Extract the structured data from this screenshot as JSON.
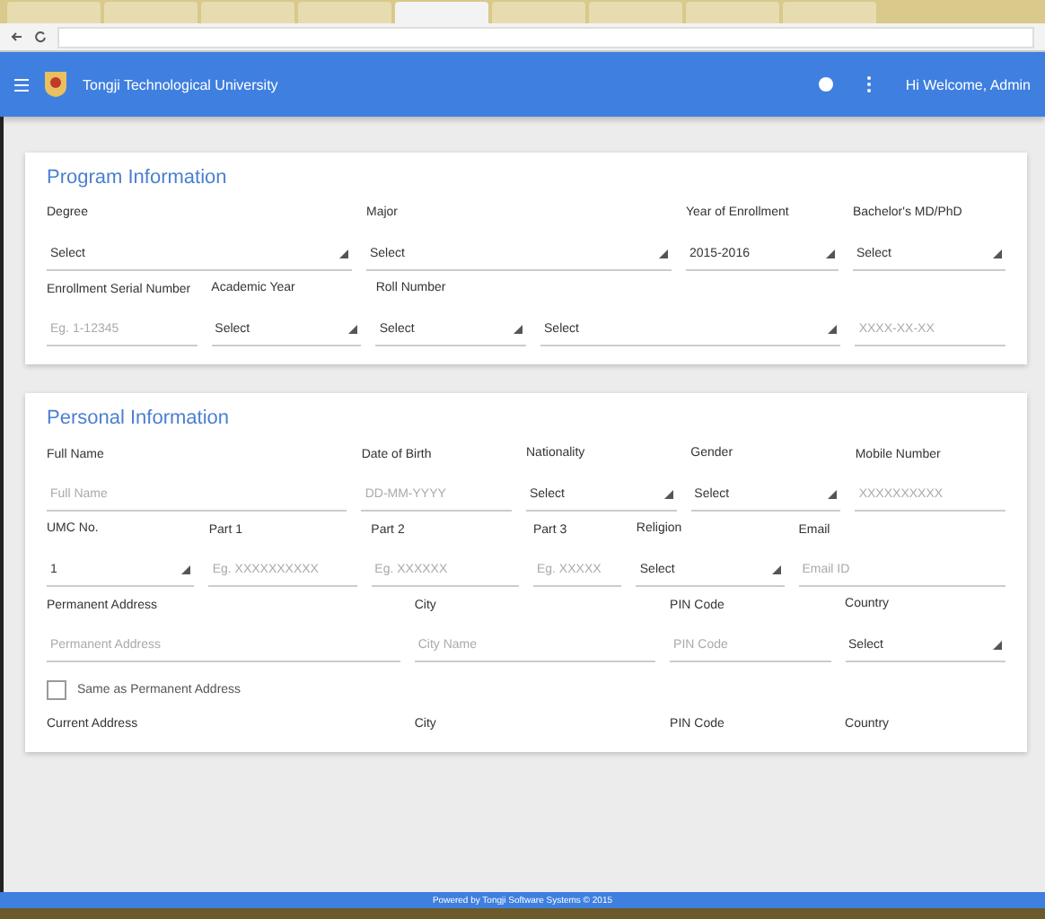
{
  "browser_tabs": [
    {
      "selected": false
    },
    {
      "selected": false
    },
    {
      "selected": false
    },
    {
      "selected": false
    },
    {
      "selected": true
    },
    {
      "selected": false
    },
    {
      "selected": false
    },
    {
      "selected": false
    },
    {
      "selected": false
    }
  ],
  "app_bar": {
    "title": "Tongji Technological University",
    "user": "Hi Welcome, Admin"
  },
  "sections": [
    {
      "title": "Program Information",
      "rows": [
        {
          "fields": [
            {
              "label": "Degree",
              "kind": "select",
              "value": "Select"
            },
            {
              "label": "Major",
              "kind": "select",
              "value": "Select"
            },
            {
              "label": "Year of Enrollment",
              "kind": "select",
              "value": "2015-2016"
            },
            {
              "label": "Bachelor's MD/PhD",
              "kind": "select",
              "value": "Select"
            }
          ]
        },
        {
          "fields": [
            {
              "label": "Enrollment Serial Number",
              "kind": "text",
              "placeholder": "Eg. 1-12345"
            },
            {
              "label": "Academic Year",
              "kind": "select",
              "value": "Select"
            },
            {
              "label": "Roll Number",
              "kind": "select",
              "value": "Select"
            },
            {
              "kind": "select",
              "value": "Select"
            },
            {
              "kind": "text",
              "placeholder": "XXXX-XX-XX"
            }
          ]
        }
      ]
    },
    {
      "title": "Personal Information",
      "rows": [
        {
          "fields": [
            {
              "label": "Full Name",
              "kind": "text",
              "placeholder": "Full Name"
            },
            {
              "label": "Date of Birth",
              "kind": "text",
              "placeholder": "DD-MM-YYYY"
            },
            {
              "label": "Nationality",
              "kind": "select",
              "value": "Select"
            },
            {
              "label": "Gender",
              "kind": "select",
              "value": "Select"
            },
            {
              "label": "Mobile Number",
              "kind": "text",
              "placeholder": "XXXXXXXXXX"
            }
          ]
        },
        {
          "fields": [
            {
              "label": "UMC No.",
              "kind": "select",
              "value": "1"
            },
            {
              "label": "Part 1",
              "kind": "text",
              "placeholder": "Eg. XXXXXXXXXX"
            },
            {
              "label": "Part 2",
              "kind": "text",
              "placeholder": "Eg. XXXXXX"
            },
            {
              "label": "Part 3",
              "kind": "text",
              "placeholder": "Eg. XXXXX"
            },
            {
              "label": "Religion",
              "kind": "select",
              "value": "Select"
            },
            {
              "label": "Email",
              "kind": "text",
              "placeholder": "Email ID"
            }
          ]
        },
        {
          "fields": [
            {
              "label": "Permanent Address",
              "kind": "text",
              "placeholder": "Permanent Address"
            },
            {
              "label": "City",
              "kind": "text",
              "placeholder": "City Name"
            },
            {
              "label": "PIN Code",
              "kind": "text",
              "placeholder": "PIN Code"
            },
            {
              "label": "Country",
              "kind": "select",
              "value": "Select"
            }
          ]
        },
        {
          "fields": [
            {
              "kind": "checkbox",
              "label": "Same as Permanent Address",
              "checked": false
            }
          ]
        },
        {
          "fields": [
            {
              "label": "Current Address",
              "kind": "label"
            },
            {
              "label": "City",
              "kind": "label"
            },
            {
              "label": "PIN Code",
              "kind": "label"
            },
            {
              "label": "Country",
              "kind": "label"
            }
          ]
        }
      ]
    }
  ],
  "footer": "Powered by Tongji Software Systems © 2015"
}
